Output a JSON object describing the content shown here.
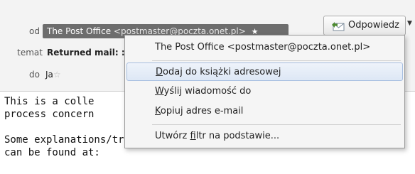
{
  "header": {
    "from_label": "od",
    "from_name": "The Post Office",
    "from_email": "<postmaster@poczta.onet.pl>",
    "subject_label": "temat",
    "subject_value": "Returned mail: :",
    "to_label": "do",
    "to_value": "Ja"
  },
  "toolbar": {
    "reply_label": "Odpowiedz"
  },
  "message": {
    "lines": [
      "This is a colle",
      "process concern",
      "",
      "Some explanations/translations for these reports",
      "can be found at:"
    ]
  },
  "context_menu": {
    "header": "The Post Office <postmaster@poczta.onet.pl>",
    "items": [
      {
        "accel": "D",
        "rest": "odaj do książki adresowej"
      },
      {
        "accel": "W",
        "rest": "yślij wiadomość do"
      },
      {
        "accel": "K",
        "rest": "opiuj adres e-mail"
      },
      {
        "pre": "Utwórz ",
        "accel": "f",
        "rest": "iltr na podstawie..."
      }
    ]
  },
  "colors": {
    "pill_bg": "#6d6d6d",
    "menu_highlight_border": "#a6bee0"
  }
}
